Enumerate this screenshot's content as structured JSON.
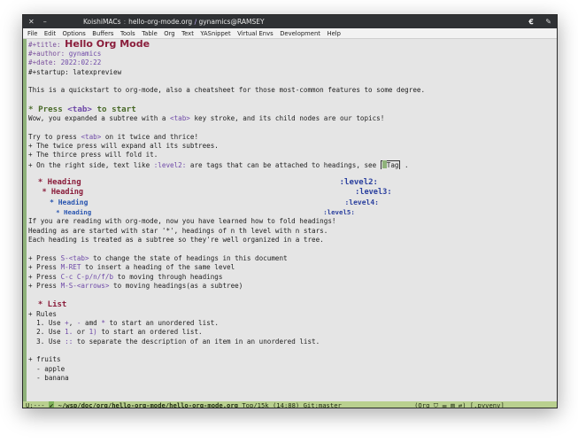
{
  "titlebar": {
    "host": "KoishiMACs",
    "file": "hello-org-mode.org",
    "user": "gynamics@RAMSEY"
  },
  "menu": [
    "File",
    "Edit",
    "Options",
    "Buffers",
    "Tools",
    "Table",
    "Org",
    "Text",
    "YASnippet",
    "Virtual Envs",
    "Development",
    "Help"
  ],
  "header": {
    "title_kw": "#+title:",
    "title_val": "Hello Org Mode",
    "author_kw": "#+author:",
    "author_val": "gynamics",
    "date_kw": "#+date:",
    "date_val": "2022:02:22",
    "startup": "#+startup: latexpreview"
  },
  "intro": "This is a quickstart to org-mode, also a cheatsheet for those most-common features to some degree.",
  "section1": {
    "heading_pre": "* Press ",
    "heading_tab": "<tab>",
    "heading_post": " to start",
    "l1_pre": "Wow, you expanded a subtree with a ",
    "l1_tab": "<tab>",
    "l1_post": " key stroke, and its child nodes are our topics!",
    "l3_pre": "Try to press ",
    "l3_tab": "<tab>",
    "l3_post": " on it twice and thrice!",
    "l4": "+ The twice press will expand all its subtrees.",
    "l5": "+ The thirce press will fold it.",
    "l6_pre": "+ On the right side, text like ",
    "l6_tag": ":level2:",
    "l6_mid": " are tags that can be attached to headings, see ",
    "l6_link": "Tag",
    "l6_post": " ."
  },
  "headings": [
    {
      "text": "* Heading",
      "tag": ":level2:"
    },
    {
      "text": "* Heading",
      "tag": ":level3:"
    },
    {
      "text": "* Heading",
      "tag": ":level4:"
    },
    {
      "text": "* Heading",
      "tag": ":level5:"
    }
  ],
  "para2": [
    "If you are reading with org-mode, now you have learned how to fold headings!",
    "Heading as are started with star '*', headings of n th level with n stars.",
    "Each heading is treated as a subtree so they're well organized in a tree."
  ],
  "keys": [
    {
      "pre": "+ Press ",
      "key": "S-<tab>",
      "post": " to change the state of headings in this document"
    },
    {
      "pre": "+ Press ",
      "key": "M-RET",
      "post": " to insert a heading of the same level"
    },
    {
      "pre": "+ Press ",
      "key": "C-c C-p/n/f/b",
      "post": " to moving through headings"
    },
    {
      "pre": "+ Press ",
      "key": "M-S-<arrows>",
      "post": " to moving headings(as a subtree)"
    }
  ],
  "list": {
    "heading": "* List",
    "rules": "+ Rules",
    "r1_pre": "  1. Use ",
    "r1_k1": "+",
    "r1_sep": ", ",
    "r1_k2": "-",
    "r1_mid": " amd ",
    "r1_k3": "*",
    "r1_post": " to start an unordered list.",
    "r2_pre": "  2. Use ",
    "r2_k1": "1.",
    "r2_mid": " or ",
    "r2_k2": "1)",
    "r2_post": " to start an ordered list.",
    "r3_pre": "  3. Use ",
    "r3_k1": "::",
    "r3_post": " to separate the description of an item in an unordered list.",
    "fruits": "+ fruits",
    "apple": "  - apple",
    "banana": "  - banana"
  },
  "modeline": {
    "state": "U:---",
    "path": "~/wsp/doc/org/hello-org-mode/hello-org-mode.org",
    "position": "Top/15k (14:88)",
    "vc": "Git:master",
    "mode": "(Org",
    "venv": "[.pyvenv]"
  },
  "colors": {
    "accent": "#8fb27a",
    "modeline": "#b9d08f",
    "title": "#8a1d3b",
    "tag": "#2a3f9e",
    "keyword": "#6f4aa8"
  }
}
